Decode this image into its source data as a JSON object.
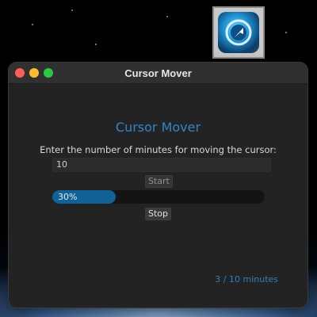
{
  "window": {
    "title": "Cursor Mover"
  },
  "app": {
    "heading": "Cursor Mover",
    "prompt": "Enter the number of minutes for moving the cursor:",
    "minutes_value": "10",
    "start_label": "Start",
    "stop_label": "Stop",
    "progress": {
      "fraction": 0.3,
      "label": "30%"
    },
    "status_text": "3 / 10 minutes"
  },
  "dock": {
    "icon": "cursor-app-icon"
  },
  "colors": {
    "accent": "#2e86c8",
    "progress_fill": "#0f6399",
    "close": "#ff5f57",
    "minimize": "#febc2e",
    "maximize": "#28c840"
  }
}
